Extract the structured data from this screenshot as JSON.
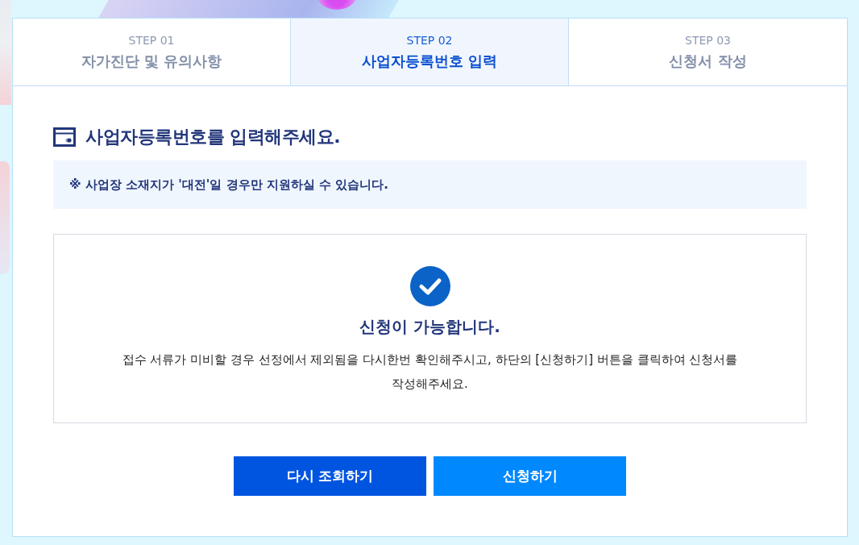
{
  "tabs": [
    {
      "step": "STEP 01",
      "label": "자가진단 및 유의사항",
      "selected": false
    },
    {
      "step": "STEP 02",
      "label": "사업자등록번호 입력",
      "selected": true
    },
    {
      "step": "STEP 03",
      "label": "신청서 작성",
      "selected": false
    }
  ],
  "section": {
    "title": "사업자등록번호를 입력해주세요."
  },
  "notice": "※ 사업장 소재지가 '대전'일 경우만 지원하실 수 있습니다.",
  "result": {
    "title": "신청이 가능합니다.",
    "message": "접수 서류가 미비할 경우 선정에서 제외됨을 다시한번 확인해주시고, 하단의 [신청하기] 버튼을 클릭하여 신청서를 작성해주세요."
  },
  "buttons": [
    {
      "label": "다시 조회하기",
      "kind": "secondary"
    },
    {
      "label": "신청하기",
      "kind": "primary"
    }
  ]
}
